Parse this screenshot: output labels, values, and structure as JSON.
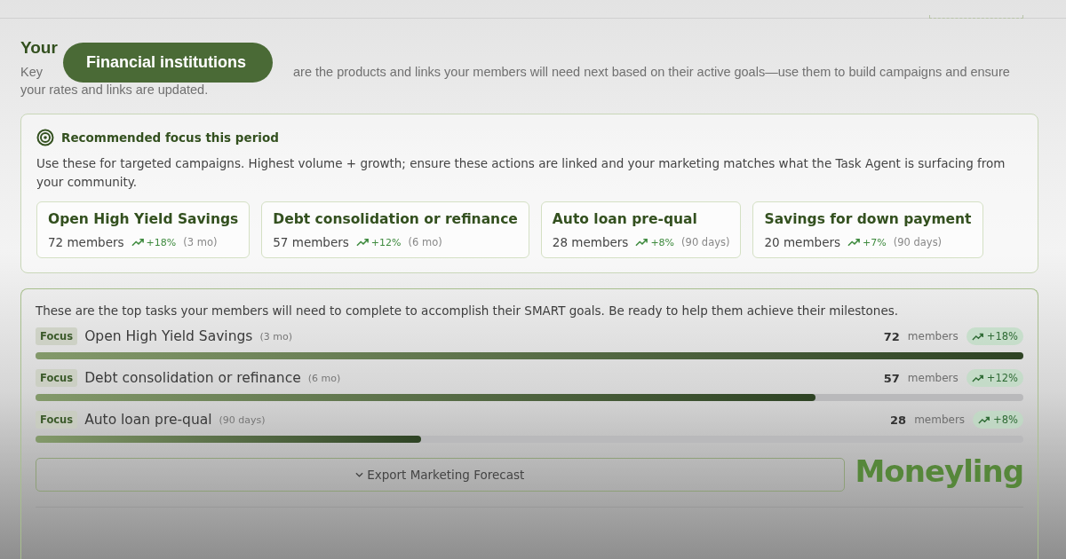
{
  "banner": {
    "label": "Financial institutions"
  },
  "logo": {
    "text": "Moneyling"
  },
  "header": {
    "title": "Your",
    "subtitle_start": "Key",
    "subtitle_line_1": "are the products and links your members will need next based on their active goals—use them to build campaigns and ensure",
    "subtitle_line_2": "your rates and links are updated."
  },
  "focus": {
    "title": "Recommended focus this period",
    "description": "Use these for targeted campaigns. Highest volume + growth; ensure these actions are linked and your marketing matches what the Task Agent is surfacing from your community.",
    "cards": [
      {
        "name": "Open High Yield Savings",
        "members": "72 members",
        "growth": "+18%",
        "period": "(3 mo)"
      },
      {
        "name": "Debt consolidation or refinance",
        "members": "57 members",
        "growth": "+12%",
        "period": "(6 mo)"
      },
      {
        "name": "Auto loan pre-qual",
        "members": "28 members",
        "growth": "+8%",
        "period": "(90 days)"
      },
      {
        "name": "Savings for down payment",
        "members": "20 members",
        "growth": "+7%",
        "period": "(90 days)"
      }
    ]
  },
  "tasks": {
    "intro": "These are the top tasks your members will need to complete to accomplish their SMART goals. Be ready to help them achieve their milestones.",
    "rows": [
      {
        "tag": "Focus",
        "name": "Open High Yield Savings",
        "period": "(3 mo)",
        "count": "72",
        "unit": "members",
        "growth": "+18%",
        "level": 1
      },
      {
        "tag": "Focus",
        "name": "Debt consolidation or refinance",
        "period": "(6 mo)",
        "count": "57",
        "unit": "members",
        "growth": "+12%",
        "level": 0.79
      },
      {
        "tag": "Focus",
        "name": "Auto loan pre-qual",
        "period": "(90 days)",
        "count": "28",
        "unit": "members",
        "growth": "+8%",
        "level": 0.39
      }
    ],
    "export_button": "Export Marketing Forecast"
  }
}
